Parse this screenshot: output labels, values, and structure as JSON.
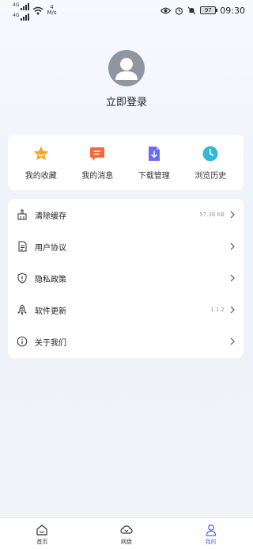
{
  "status_bar": {
    "network_1": "4G",
    "network_2": "4G",
    "speed_value": "4",
    "speed_unit": "M/s",
    "battery": "97",
    "time": "09:30"
  },
  "profile": {
    "login_label": "立即登录"
  },
  "quick_actions": [
    {
      "label": "我的收藏",
      "icon": "star-icon",
      "color": "#f5a623"
    },
    {
      "label": "我的消息",
      "icon": "message-icon",
      "color": "#f2683c"
    },
    {
      "label": "下载管理",
      "icon": "download-icon",
      "color": "#6b6cf0"
    },
    {
      "label": "浏览历史",
      "icon": "clock-icon",
      "color": "#34b8d6"
    }
  ],
  "menu": [
    {
      "label": "清除缓存",
      "icon": "broom-icon",
      "value": "57.36 KB"
    },
    {
      "label": "用户协议",
      "icon": "document-icon",
      "value": ""
    },
    {
      "label": "隐私政策",
      "icon": "shield-icon",
      "value": ""
    },
    {
      "label": "软件更新",
      "icon": "rocket-icon",
      "value": "1.1.2"
    },
    {
      "label": "关于我们",
      "icon": "info-icon",
      "value": ""
    }
  ],
  "bottom_nav": [
    {
      "label": "首页",
      "icon": "home-icon"
    },
    {
      "label": "网盘",
      "icon": "cloud-drive-icon"
    },
    {
      "label": "我的",
      "icon": "person-icon",
      "active": true
    }
  ],
  "colors": {
    "accent": "#5b6ce6",
    "avatar_bg": "#8f96a2"
  }
}
